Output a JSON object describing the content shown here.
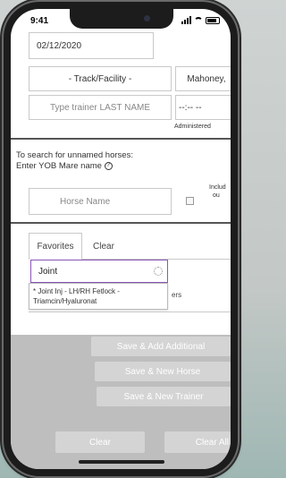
{
  "status_bar": {
    "time": "9:41"
  },
  "form": {
    "date_value": "02/12/2020",
    "track_placeholder": "- Track/Facility -",
    "mahoney_value": "Mahoney,",
    "trainer_placeholder": "Type trainer LAST NAME",
    "time_value": "--:-- --",
    "administered_label": "Administered",
    "unnamed_hint_line1": "To search for unnamed horses:",
    "unnamed_hint_line2": "Enter YOB Mare name",
    "help_icon_glyph": "?",
    "horse_name_placeholder": "Horse Name",
    "include_line1": "Includ",
    "include_line2": "ou"
  },
  "tabs": {
    "favorites": "Favorites",
    "clear": "Clear"
  },
  "autocomplete": {
    "query": "Joint",
    "suggestion_line1": "* Joint Inj - LH/RH Fetlock -",
    "suggestion_line2": "Triamcin/Hyaluronat",
    "partial_text": "ers"
  },
  "actions": {
    "save_add_additional": "Save & Add Additional",
    "save_new_horse": "Save & New Horse",
    "save_new_trainer": "Save & New Trainer",
    "clear": "Clear",
    "clear_all": "Clear All"
  },
  "colors": {
    "accent": "#8a56b8",
    "overlay": "#bebebe",
    "button": "#d4d4d4"
  }
}
